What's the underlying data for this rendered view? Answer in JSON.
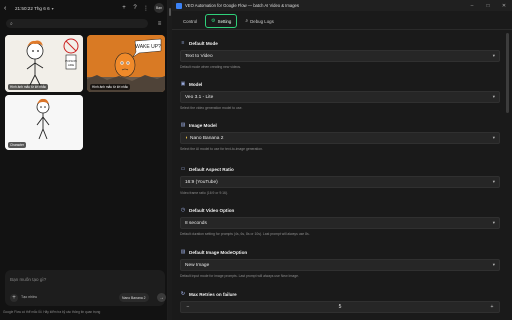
{
  "left": {
    "time_title": "21:50:22 Thg 6 6",
    "search_placeholder": "",
    "avatar_text": "Bạn",
    "thumbnails": [
      {
        "caption": "Hình ảnh mẫu từ lời nhắc"
      },
      {
        "caption": "Hình ảnh mẫu từ lời nhắc"
      },
      {
        "caption": "Character"
      }
    ],
    "prompt": {
      "placeholder": "Bạn muốn tạo gì?",
      "mode_label": "Tạo nhiều",
      "model_label": "Nano Banana 2"
    },
    "disclaimer": "Google Flow có thể mắc lỗi. Hãy kiểm tra kỹ các thông tin quan trọng"
  },
  "right": {
    "window_title": "VEO Automation for Google Flow — batch AI Video & Images",
    "tabs": [
      {
        "label": "Control"
      },
      {
        "label": "Setting"
      },
      {
        "label": "Debug Logs"
      }
    ],
    "sections": {
      "default_mode": {
        "label": "Default Mode",
        "value": "Text to Video",
        "hint": "Default mode when creating new videos."
      },
      "model": {
        "label": "Model",
        "value": "Veo 3.1 - Lite",
        "hint": "Select the video generation model to use."
      },
      "image_model": {
        "label": "Image Model",
        "value": "Nano Banana 2",
        "hint": "Select the AI model to use for text-to-image generation."
      },
      "aspect_ratio": {
        "label": "Default Aspect Ratio",
        "value": "16:9 (YouTube)",
        "hint": "Video frame ratio (16:9 or 9:16)."
      },
      "video_option": {
        "label": "Default Video Option",
        "value": "8 seconds",
        "hint": "Default duration setting for prompts (4s, 6s, 8s or 10s). Last prompt will always use 8s."
      },
      "image_mode_option": {
        "label": "Default Image ModeOption",
        "value": "New Image",
        "hint": "Default input mode for image prompts. Last prompt will always use New Image."
      },
      "max_retries": {
        "label": "Max Retries on failure",
        "value": "5"
      }
    }
  }
}
